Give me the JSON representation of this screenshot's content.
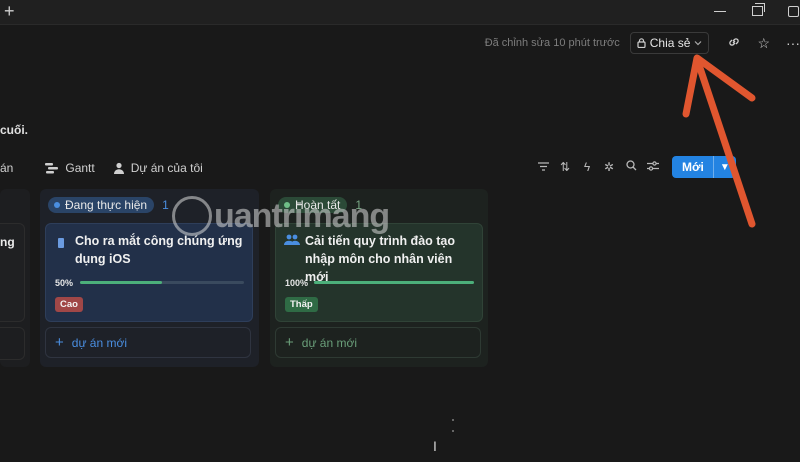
{
  "header": {
    "edited_text": "Đã chỉnh sửa 10 phút trước",
    "share_label": "Chia sẻ"
  },
  "description": "cuối.",
  "views": [
    "án",
    "Gantt",
    "Dự án của tôi"
  ],
  "toolbar": {
    "new_label": "Mới"
  },
  "columns": [
    {
      "status": "Đang thực hiện",
      "count": "1",
      "card": {
        "title": "Cho ra mắt công chúng ứng dụng iOS",
        "percent": "50%",
        "progress": 0.5,
        "tag": "Cao"
      },
      "add_label": "dự án mới"
    },
    {
      "status": "Hoàn tất",
      "count": "1",
      "card": {
        "title": "Cải tiến quy trình đào tạo nhập môn cho nhân viên mới",
        "percent": "100%",
        "progress": 1.0,
        "tag": "Thấp"
      },
      "add_label": "dự án mới"
    }
  ],
  "left_column": {
    "card_text": "ng"
  },
  "watermark": "uantrimang",
  "colors": {
    "accent": "#2383e2",
    "arrow": "#e0562f",
    "progress": "#4caf7a"
  }
}
